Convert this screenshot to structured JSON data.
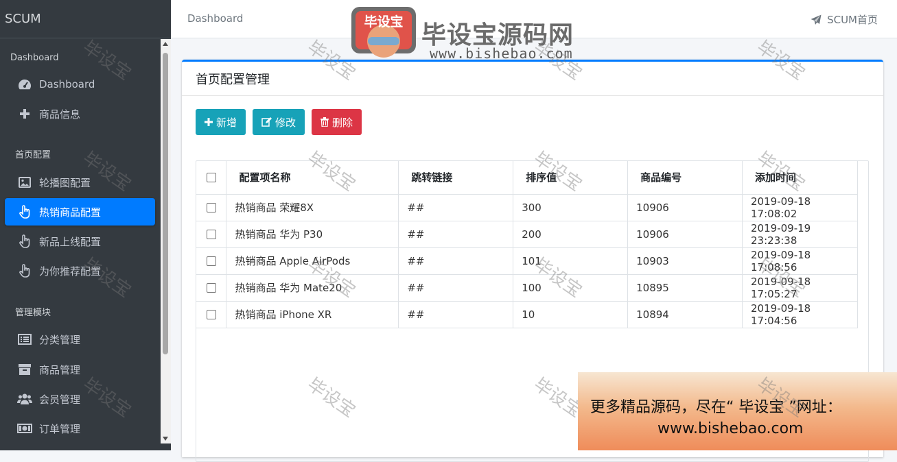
{
  "brand": "SCUM",
  "sidebar": {
    "headers": [
      "Dashboard",
      "首页配置",
      "管理模块"
    ],
    "items": [
      {
        "label": "Dashboard",
        "icon": "tachometer-icon"
      },
      {
        "label": "商品信息",
        "icon": "plus-icon"
      },
      {
        "label": "轮播图配置",
        "icon": "image-icon"
      },
      {
        "label": "热销商品配置",
        "icon": "hand-pointer-icon"
      },
      {
        "label": "新品上线配置",
        "icon": "hand-pointer-icon"
      },
      {
        "label": "为你推荐配置",
        "icon": "hand-pointer-icon"
      },
      {
        "label": "分类管理",
        "icon": "list-icon"
      },
      {
        "label": "商品管理",
        "icon": "archive-icon"
      },
      {
        "label": "会员管理",
        "icon": "users-icon"
      },
      {
        "label": "订单管理",
        "icon": "money-icon"
      }
    ],
    "active_index": 3
  },
  "topbar": {
    "breadcrumb": "Dashboard",
    "home_link": "SCUM首页"
  },
  "watermark": {
    "logo_badge": "毕设宝",
    "logo_title": "毕设宝源码网",
    "logo_url": "www.bishebao.com",
    "tile": "毕设宝"
  },
  "card": {
    "title": "首页配置管理",
    "buttons": {
      "add": "新增",
      "edit": "修改",
      "delete": "删除"
    }
  },
  "table": {
    "columns": [
      "配置项名称",
      "跳转链接",
      "排序值",
      "商品编号",
      "添加时间"
    ],
    "rows": [
      [
        "热销商品 荣耀8X",
        "##",
        "300",
        "10906",
        "2019-09-18 17:08:02"
      ],
      [
        "热销商品 华为 P30",
        "##",
        "200",
        "10906",
        "2019-09-19 23:23:38"
      ],
      [
        "热销商品 Apple AirPods",
        "##",
        "101",
        "10903",
        "2019-09-18 17:08:56"
      ],
      [
        "热销商品 华为 Mate20",
        "##",
        "100",
        "10895",
        "2019-09-18 17:05:27"
      ],
      [
        "热销商品 iPhone XR",
        "##",
        "10",
        "10894",
        "2019-09-18 17:04:56"
      ]
    ]
  },
  "banner": {
    "line1": "更多精品源码，尽在“ 毕设宝 ”网址：",
    "line2": "www.bishebao.com"
  },
  "colors": {
    "sidebar_bg": "#343a40",
    "active": "#007bff",
    "info": "#17a2b8",
    "danger": "#dc3545"
  }
}
